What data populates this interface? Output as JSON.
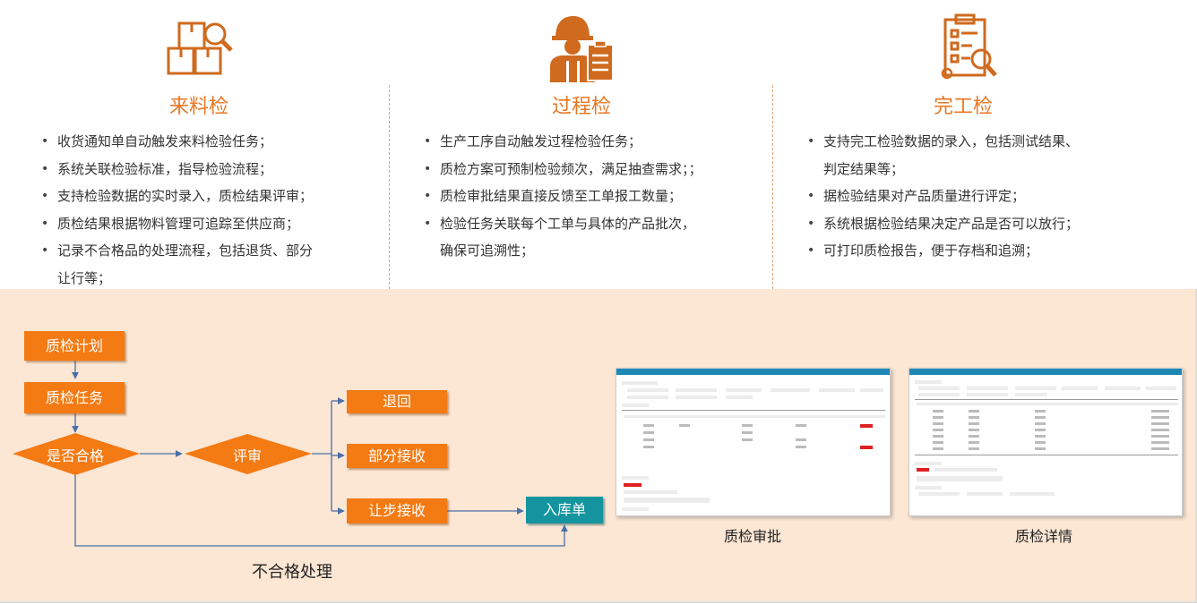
{
  "sections": [
    {
      "title": "来料检",
      "icon": "boxes-magnifier-icon",
      "items": [
        "收货通知单自动触发来料检验任务；",
        "系统关联检验标准，指导检验流程；",
        "支持检验数据的实时录入，质检结果评审；",
        "质检结果根据物料管理可追踪至供应商；",
        "记录不合格品的处理流程，包括退货、部分\n让行等；"
      ]
    },
    {
      "title": "过程检",
      "icon": "worker-clipboard-icon",
      "items": [
        "生产工序自动触发过程检验任务；",
        "质检方案可预制检验频次，满足抽查需求；；",
        "质检审批结果直接反馈至工单报工数量；",
        "检验任务关联每个工单与具体的产品批次，\n确保可追溯性；"
      ]
    },
    {
      "title": "完工检",
      "icon": "checklist-gear-icon",
      "items": [
        "支持完工检验数据的录入，包括测试结果、\n判定结果等；",
        "据检验结果对产品质量进行评定；",
        "系统根据检验结果决定产品是否可以放行；",
        "可打印质检报告，便于存档和追溯；"
      ]
    }
  ],
  "flow": {
    "plan": "质检计划",
    "task": "质检任务",
    "qualified": "是否合格",
    "review": "评审",
    "return": "退回",
    "partial": "部分接收",
    "concession": "让步接收",
    "warehouse": "入库单",
    "unqualified_label": "不合格处理"
  },
  "screenshots": [
    {
      "caption": "质检审批"
    },
    {
      "caption": "质检详情"
    }
  ],
  "colors": {
    "accent": "#e87722",
    "box": "#f47a14",
    "teal": "#14949e",
    "panel": "#fce6d4",
    "line": "#4a6fa8"
  }
}
